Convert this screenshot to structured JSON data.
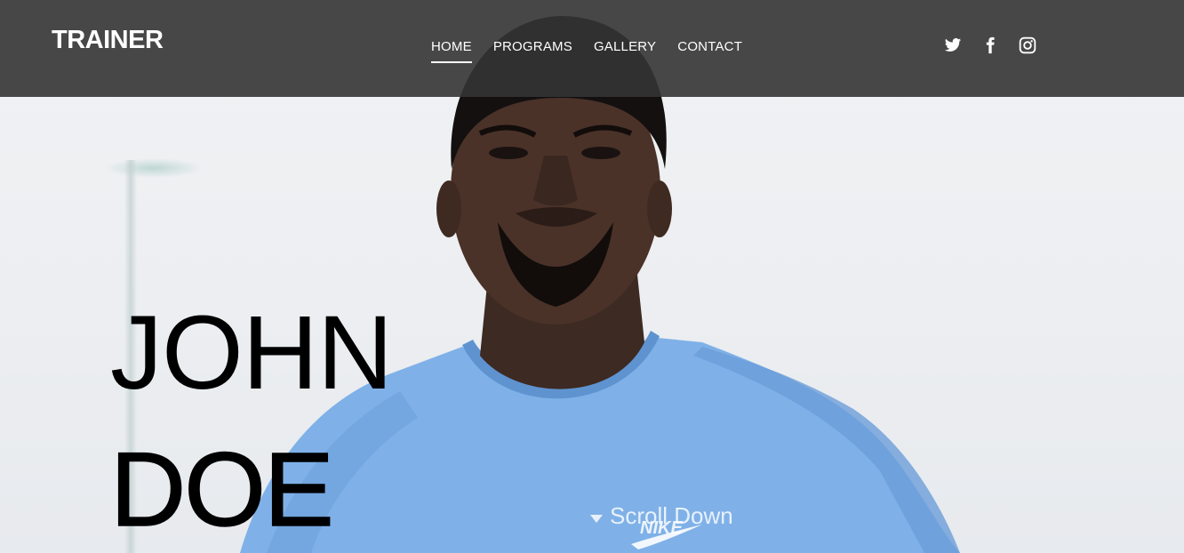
{
  "header": {
    "brand": "TRAINER",
    "nav": [
      {
        "label": "HOME",
        "active": true
      },
      {
        "label": "PROGRAMS",
        "active": false
      },
      {
        "label": "GALLERY",
        "active": false
      },
      {
        "label": "CONTACT",
        "active": false
      }
    ],
    "social": [
      "twitter-icon",
      "facebook-icon",
      "instagram-icon"
    ]
  },
  "hero": {
    "first_name": "JOHN",
    "last_name": "DOE",
    "scroll_label": "Scroll Down",
    "image": "man-in-blue-t-shirt"
  },
  "colors": {
    "topbar": "#343434",
    "text_light": "#ffffff",
    "hero_text": "#000000",
    "shirt": "#7fb1e8"
  }
}
